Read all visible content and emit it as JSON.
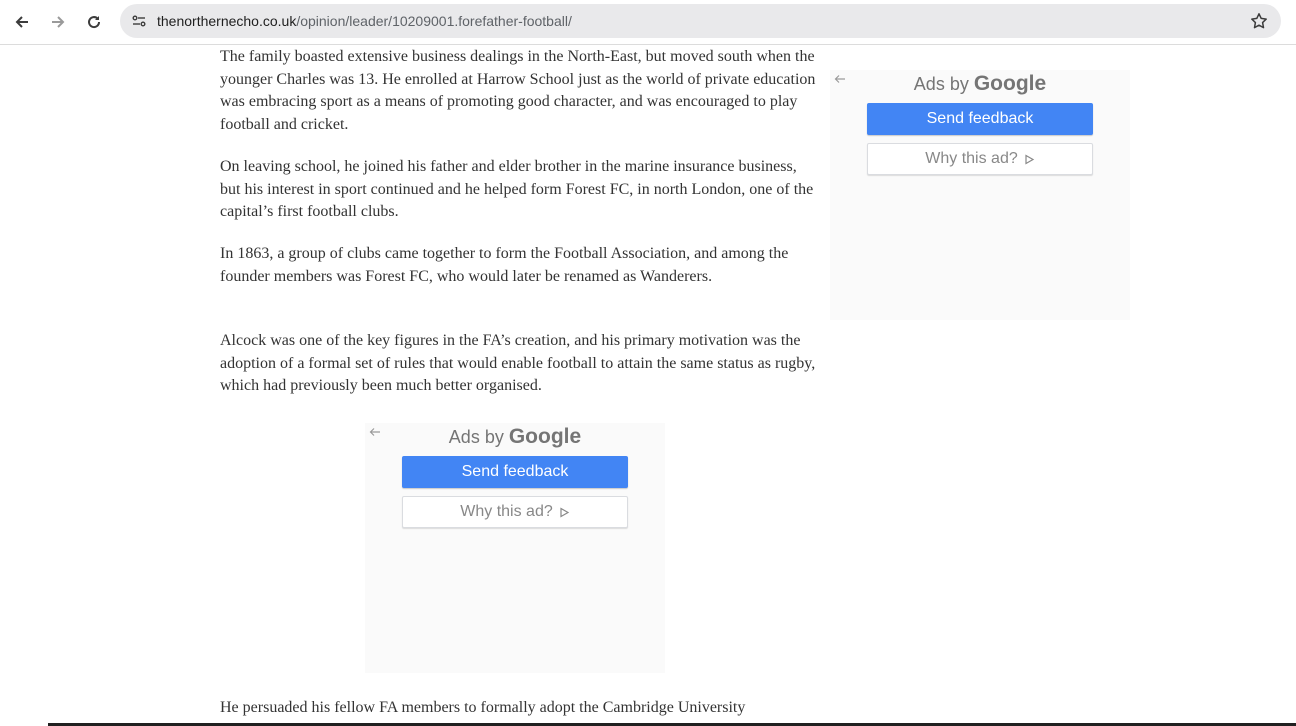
{
  "browser": {
    "url_domain": "thenorthernecho.co.uk",
    "url_path": "/opinion/leader/10209001.forefather-football/",
    "icons": [
      "back-arrow-icon",
      "forward-arrow-icon",
      "reload-icon",
      "site-info-icon",
      "bookmark-star-icon"
    ]
  },
  "article": {
    "paragraphs": [
      "The family boasted extensive business dealings in the North-East, but moved south when the younger Charles was 13. He enrolled at Harrow School just as the world of private education was embracing sport as a means of promoting good character, and was encouraged to play football and cricket.",
      "On leaving school, he joined his father and elder brother in the marine insurance business, but his interest in sport continued and he helped form Forest FC, in north London, one of the capital’s first football clubs.",
      "In 1863, a group of clubs came together to form the Football Association, and among the founder members was Forest FC, who would later be renamed as Wanderers.",
      "Alcock was one of the key figures in the FA’s creation, and his primary motivation was the adoption of a formal set of rules that would enable football to attain the same status as rugby, which had previously been much better organised.",
      "He persuaded his fellow FA members to formally adopt the Cambridge University"
    ]
  },
  "ads": {
    "ads_by": "Ads by",
    "google": "Google",
    "send_feedback": "Send feedback",
    "why_this_ad": "Why this ad?",
    "colors": {
      "button_blue": "#4285f4",
      "panel_bg": "#fafafa"
    }
  }
}
